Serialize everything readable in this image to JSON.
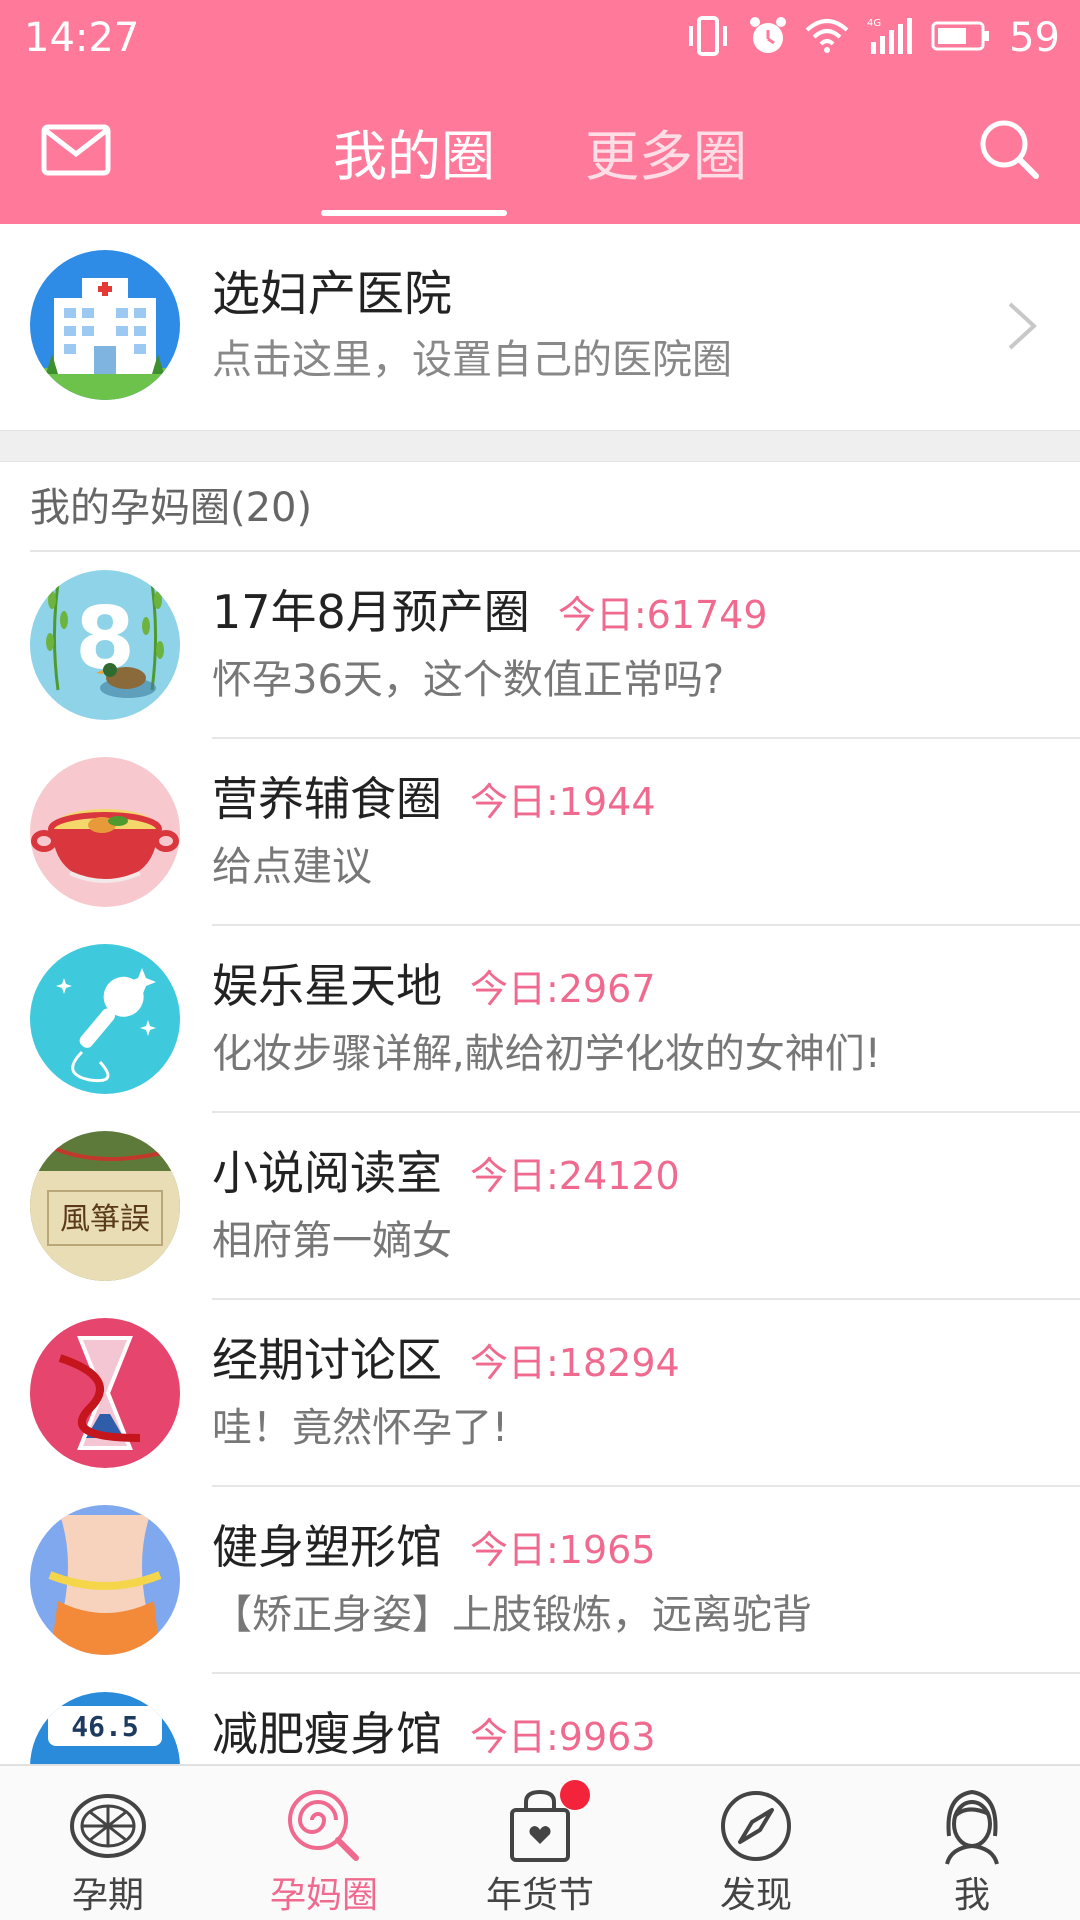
{
  "status_bar": {
    "time": "14:27",
    "battery": "59",
    "network": "4G"
  },
  "header": {
    "tabs": [
      {
        "label": "我的圈",
        "active": true
      },
      {
        "label": "更多圈",
        "active": false
      }
    ]
  },
  "hospital_card": {
    "title": "选妇产医院",
    "subtitle": "点击这里，设置自己的医院圈"
  },
  "section": {
    "title": "我的孕妈圈(20)"
  },
  "circles": [
    {
      "name": "17年8月预产圈",
      "today": "今日:61749",
      "desc": "怀孕36天，这个数值正常吗?"
    },
    {
      "name": "营养辅食圈",
      "today": "今日:1944",
      "desc": "给点建议"
    },
    {
      "name": "娱乐星天地",
      "today": "今日:2967",
      "desc": "化妆步骤详解,献给初学化妆的女神们!"
    },
    {
      "name": "小说阅读室",
      "today": "今日:24120",
      "desc": "相府第一嫡女"
    },
    {
      "name": "经期讨论区",
      "today": "今日:18294",
      "desc": "哇！竟然怀孕了!"
    },
    {
      "name": "健身塑形馆",
      "today": "今日:1965",
      "desc": "【矫正身姿】上肢锻炼，远离驼背"
    },
    {
      "name": "减肥瘦身馆",
      "today": "今日:9963",
      "desc": ""
    }
  ],
  "avatar_art": {
    "novel_text": "風箏誤",
    "scale_text": "46.5"
  },
  "bottom_nav": [
    {
      "label": "孕期",
      "icon": "pregnancy-icon",
      "active": false
    },
    {
      "label": "孕妈圈",
      "icon": "lollipop-icon",
      "active": true
    },
    {
      "label": "年货节",
      "icon": "shopping-bag-icon",
      "active": false,
      "badge": true
    },
    {
      "label": "发现",
      "icon": "compass-icon",
      "active": false
    },
    {
      "label": "我",
      "icon": "profile-icon",
      "active": false
    }
  ],
  "colors": {
    "brand_pink": "#FF7A9A",
    "accent_pink": "#F06A8F",
    "badge_red": "#F2233A"
  }
}
